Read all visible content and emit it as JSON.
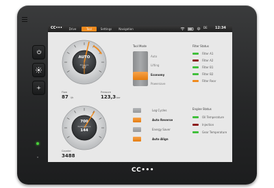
{
  "device": {
    "brand": "CC•••",
    "side_buttons": [
      "power-icon",
      "brightness-icon",
      "dim-icon"
    ],
    "colors": {
      "accent": "#f08a1c",
      "bezel": "#2a2b2c",
      "led_green": "#4ad13a"
    }
  },
  "topbar": {
    "logo": "CC•••",
    "tabs": [
      {
        "label": "Drive",
        "active": false
      },
      {
        "label": "Tool",
        "active": true
      },
      {
        "label": "Settings",
        "active": false
      },
      {
        "label": "Navigation",
        "active": false
      }
    ],
    "status_icons": [
      "wifi-icon",
      "battery-icon",
      "settings-icon"
    ],
    "status_text": "DE",
    "time": "12:34"
  },
  "gauges": {
    "upper": {
      "mode": "AUTO",
      "sublabel": "Pressure",
      "value": "67"
    },
    "lower": {
      "value": "700",
      "sublabel": "Performance",
      "value2": "144"
    }
  },
  "readouts": {
    "flow": {
      "label": "Flow",
      "value": "87",
      "unit": "l/h"
    },
    "pressure": {
      "label": "Pressure",
      "value": "123,3",
      "unit": "bar"
    },
    "counter": {
      "label": "Counter",
      "value": "3488"
    }
  },
  "tool_mode": {
    "title": "Tool Mode",
    "items": [
      {
        "label": "Auto",
        "active": false
      },
      {
        "label": "Lifting",
        "active": false
      },
      {
        "label": "Economy",
        "active": true
      },
      {
        "label": "Powersave",
        "active": false
      }
    ]
  },
  "filter_status": {
    "title": "Filter Status",
    "items": [
      {
        "label": "Filter A1",
        "color": "#3fbf3a"
      },
      {
        "label": "Filter A2",
        "color": "#8b1a1a"
      },
      {
        "label": "Filter B1",
        "color": "#3fbf3a"
      },
      {
        "label": "Filter B2",
        "color": "#3fbf3a"
      },
      {
        "label": "Filter Rear",
        "color": "#f08a1c"
      }
    ]
  },
  "options": [
    {
      "label": "Log Cycles",
      "on": false
    },
    {
      "label": "Auto Reverse",
      "on": true
    },
    {
      "label": "Energy Saver",
      "on": false
    },
    {
      "label": "Auto Align",
      "on": true
    }
  ],
  "engine_status": {
    "title": "Engine Status",
    "items": [
      {
        "label": "Oil Temperature",
        "color": "#3fbf3a"
      },
      {
        "label": "Injection",
        "color": "#8b1a1a"
      },
      {
        "label": "Gear Temperature",
        "color": "#3fbf3a"
      }
    ]
  }
}
